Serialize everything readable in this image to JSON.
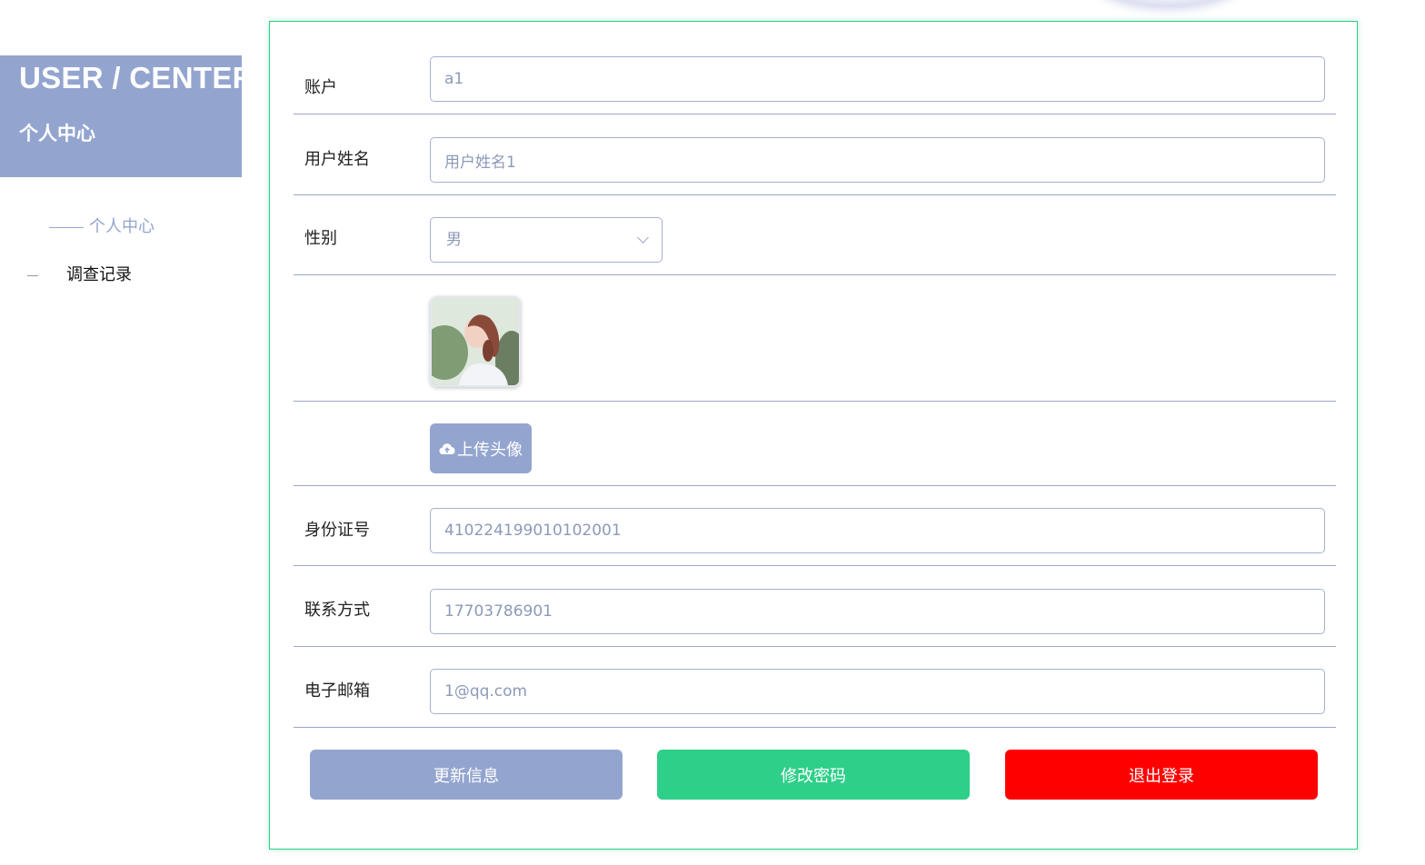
{
  "sidebar": {
    "title_en": "USER / CENTER",
    "title_cn": "个人中心",
    "items": [
      {
        "label": "个人中心",
        "active": true
      },
      {
        "label": "调查记录",
        "active": false
      }
    ]
  },
  "form": {
    "account": {
      "label": "账户",
      "value": "a1"
    },
    "name": {
      "label": "用户姓名",
      "value": "用户姓名1"
    },
    "gender": {
      "label": "性别",
      "value": "男"
    },
    "avatar": {
      "alt": "avatar"
    },
    "upload": {
      "label": "上传头像"
    },
    "id_number": {
      "label": "身份证号",
      "value": "410224199010102001"
    },
    "phone": {
      "label": "联系方式",
      "value": "17703786901"
    },
    "email": {
      "label": "电子邮箱",
      "value": "1@qq.com"
    }
  },
  "actions": {
    "update": "更新信息",
    "change_password": "修改密码",
    "logout": "退出登录"
  },
  "colors": {
    "primary": "#93a5cf",
    "success": "#2ecf89",
    "danger": "#ff0000",
    "card_border": "#2ecc87"
  },
  "icons": {
    "upload": "cloud-upload-icon",
    "select": "chevron-down-icon"
  }
}
